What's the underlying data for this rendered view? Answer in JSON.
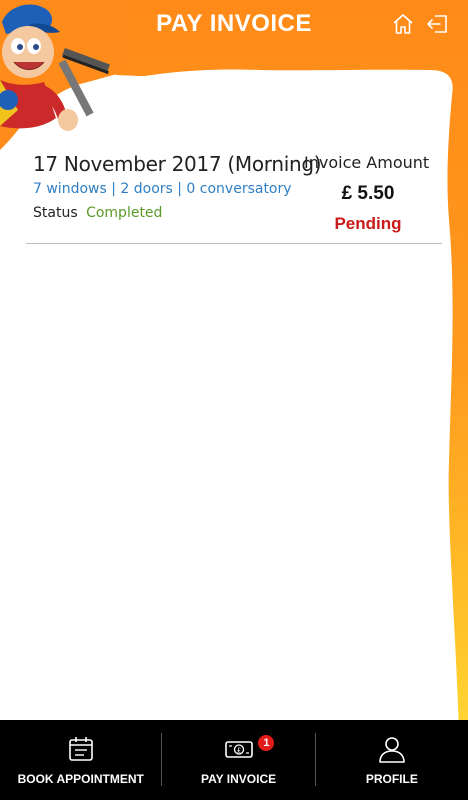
{
  "header": {
    "title": "PAY INVOICE",
    "home_icon": "home-icon",
    "logout_icon": "logout-icon"
  },
  "invoice": {
    "date": "17 November 2017 (Morning)",
    "items": "7 windows | 2 doors | 0 conversatory",
    "status_label": "Status",
    "status_value": "Completed",
    "amount_label": "Invoice Amount",
    "amount": "£ 5.50",
    "payment_status": "Pending"
  },
  "colors": {
    "brand_orange": "#ff8a18",
    "link_blue": "#2f7fc4",
    "status_green": "#5a9a2a",
    "pending_red": "#cc1a1a",
    "nav_bg": "#000000"
  },
  "bottom_nav": {
    "book_label": "BOOK APPOINTMENT",
    "pay_label": "PAY INVOICE",
    "pay_badge": "1",
    "profile_label": "PROFILE"
  }
}
